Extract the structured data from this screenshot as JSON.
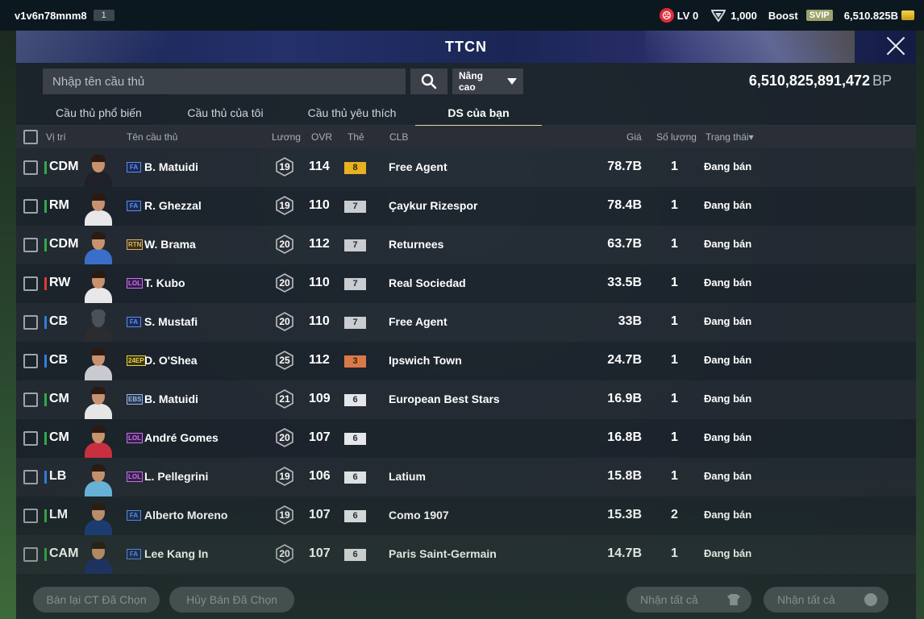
{
  "topbar": {
    "username": "v1v6n78mnm8",
    "user_badge": "1",
    "level": "LV 0",
    "shield_count": "1,000",
    "boost_label": "Boost",
    "svip_label": "SVIP",
    "balance": "6,510.825B"
  },
  "modal": {
    "title": "TTCN"
  },
  "search": {
    "placeholder": "Nhập tên cầu thủ",
    "advanced_label": "Nâng cao",
    "bp_amount": "6,510,825,891,472",
    "bp_unit": "BP"
  },
  "tabs": [
    {
      "label": "Cầu thủ phổ biến",
      "active": false
    },
    {
      "label": "Cầu thủ của tôi",
      "active": false
    },
    {
      "label": "Cầu thủ yêu thích",
      "active": false
    },
    {
      "label": "DS của bạn",
      "active": true
    }
  ],
  "columns": {
    "position": "Vị trí",
    "name": "Tên cầu thủ",
    "wage": "Lương",
    "ovr": "OVR",
    "grade": "Thẻ",
    "club": "CLB",
    "price": "Giá",
    "quantity": "Số lượng",
    "status": "Trạng thái▾"
  },
  "players": [
    {
      "position": "CDM",
      "pos_color": "#2faa4a",
      "season": "FA",
      "name": "B. Matuidi",
      "wage": "19",
      "ovr": "114",
      "grade": "8",
      "grade_color": "#e6b21f",
      "club": "Free Agent",
      "price": "78.7B",
      "quantity": "1",
      "status": "Đang bán"
    },
    {
      "position": "RM",
      "pos_color": "#2faa4a",
      "season": "FA",
      "name": "R. Ghezzal",
      "wage": "19",
      "ovr": "110",
      "grade": "7",
      "grade_color": "#c9ccd1",
      "club": "Çaykur Rizespor",
      "price": "78.4B",
      "quantity": "1",
      "status": "Đang bán"
    },
    {
      "position": "CDM",
      "pos_color": "#2faa4a",
      "season": "RTN",
      "name": "W. Brama",
      "wage": "20",
      "ovr": "112",
      "grade": "7",
      "grade_color": "#c9ccd1",
      "club": "Returnees",
      "price": "63.7B",
      "quantity": "1",
      "status": "Đang bán"
    },
    {
      "position": "RW",
      "pos_color": "#e03a3a",
      "season": "LOL",
      "name": "T. Kubo",
      "wage": "20",
      "ovr": "110",
      "grade": "7",
      "grade_color": "#c9ccd1",
      "club": "Real Sociedad",
      "price": "33.5B",
      "quantity": "1",
      "status": "Đang bán"
    },
    {
      "position": "CB",
      "pos_color": "#2f7de0",
      "season": "FA",
      "name": "S. Mustafi",
      "wage": "20",
      "ovr": "110",
      "grade": "7",
      "grade_color": "#c9ccd1",
      "club": "Free Agent",
      "price": "33B",
      "quantity": "1",
      "status": "Đang bán"
    },
    {
      "position": "CB",
      "pos_color": "#2f7de0",
      "season": "24EP",
      "name": "D. O'Shea",
      "wage": "25",
      "ovr": "112",
      "grade": "3",
      "grade_color": "#d9794a",
      "club": "Ipswich Town",
      "price": "24.7B",
      "quantity": "1",
      "status": "Đang bán"
    },
    {
      "position": "CM",
      "pos_color": "#2faa4a",
      "season": "EBS",
      "name": "B. Matuidi",
      "wage": "21",
      "ovr": "109",
      "grade": "6",
      "grade_color": "#e4e6ea",
      "club": "European Best Stars",
      "price": "16.9B",
      "quantity": "1",
      "status": "Đang bán"
    },
    {
      "position": "CM",
      "pos_color": "#2faa4a",
      "season": "LOL",
      "name": "André Gomes",
      "wage": "20",
      "ovr": "107",
      "grade": "6",
      "grade_color": "#e4e6ea",
      "club": "",
      "price": "16.8B",
      "quantity": "1",
      "status": "Đang bán"
    },
    {
      "position": "LB",
      "pos_color": "#2f7de0",
      "season": "LOL",
      "name": "L. Pellegrini",
      "wage": "19",
      "ovr": "106",
      "grade": "6",
      "grade_color": "#e4e6ea",
      "club": "Latium",
      "price": "15.8B",
      "quantity": "1",
      "status": "Đang bán"
    },
    {
      "position": "LM",
      "pos_color": "#2faa4a",
      "season": "FA",
      "name": "Alberto Moreno",
      "wage": "19",
      "ovr": "107",
      "grade": "6",
      "grade_color": "#e4e6ea",
      "club": "Como 1907",
      "price": "15.3B",
      "quantity": "2",
      "status": "Đang bán"
    },
    {
      "position": "CAM",
      "pos_color": "#2faa4a",
      "season": "FA",
      "name": "Lee Kang In",
      "wage": "20",
      "ovr": "107",
      "grade": "6",
      "grade_color": "#e4e6ea",
      "club": "Paris Saint-Germain",
      "price": "14.7B",
      "quantity": "1",
      "status": "Đang bán"
    }
  ],
  "footer": {
    "resell_label": "Bán lại CT Đã Chọn",
    "cancel_label": "Hủy Bán Đã Chọn",
    "receive_all_1": "Nhận tất cả",
    "receive_all_2": "Nhận tất cả"
  }
}
